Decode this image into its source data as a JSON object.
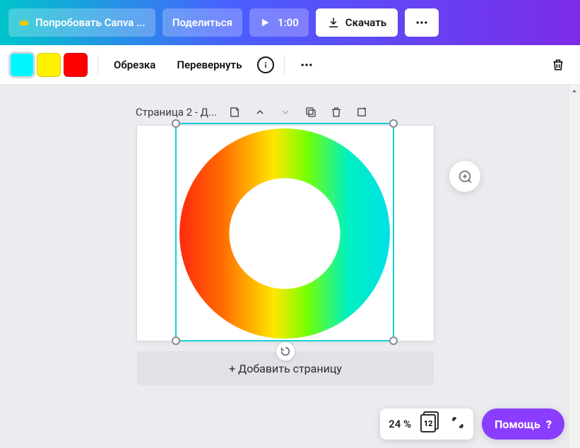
{
  "topbar": {
    "try_label": "Попробовать Canva ...",
    "share_label": "Поделиться",
    "duration": "1:00",
    "download_label": "Скачать"
  },
  "toolbar": {
    "swatches": [
      "#00f7ff",
      "#fff200",
      "#ff0000"
    ],
    "crop_label": "Обрезка",
    "flip_label": "Перевернуть"
  },
  "page": {
    "label": "Страница 2 - Д..."
  },
  "add_page_label": "+ Добавить страницу",
  "zoom": {
    "pct": "24 %",
    "page_count": "12"
  },
  "help_label": "Помощь"
}
